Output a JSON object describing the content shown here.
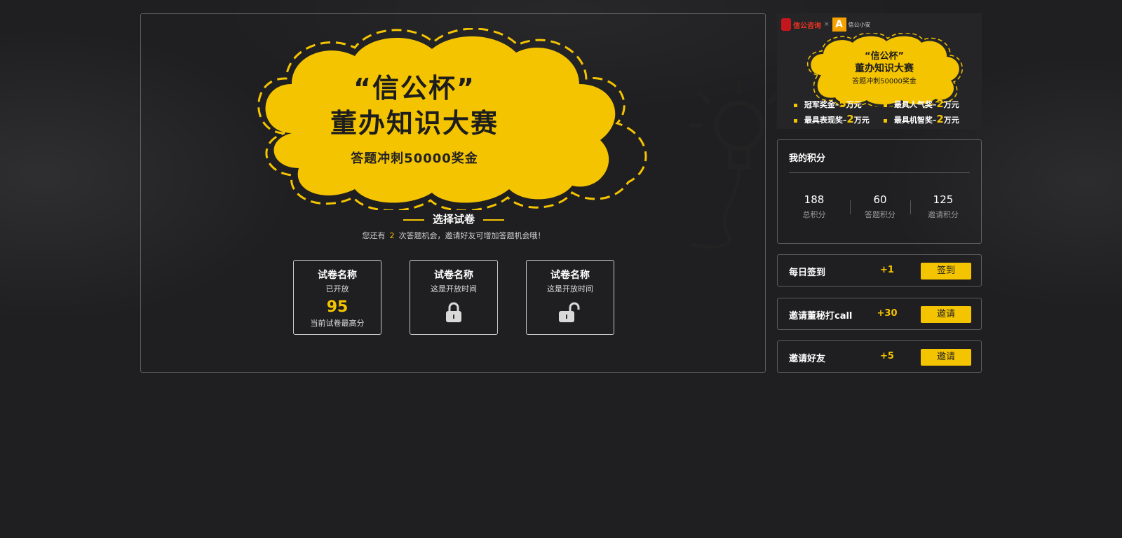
{
  "hero": {
    "title_line1": "“信公杯”",
    "title_line2": "董办知识大赛",
    "subtitle": "答题冲刺50000奖金"
  },
  "section": {
    "title": "选择试卷",
    "hint_prefix": "您还有",
    "hint_count": "2",
    "hint_suffix": "次答题机会，邀请好友可增加答题机会哦！"
  },
  "papers": [
    {
      "name": "试卷名称",
      "status": "已开放",
      "score": "95",
      "score_label": "当前试卷最高分",
      "state": "open"
    },
    {
      "name": "试卷名称",
      "status": "这是开放时间",
      "state": "locked"
    },
    {
      "name": "试卷名称",
      "status": "这是开放时间",
      "state": "unlocked"
    }
  ],
  "banner": {
    "brand1": "信公咨询",
    "brand_sep": "×",
    "brand2_logo": "A",
    "brand2": "信公小安",
    "title_line1": "“信公杯”",
    "title_line2": "董办知识大赛",
    "subtitle": "答题冲刺50000奖金",
    "prizes": [
      {
        "label": "冠军奖金–",
        "amount": "5",
        "unit": "万元"
      },
      {
        "label": "最具人气奖–",
        "amount": "2",
        "unit": "万元"
      },
      {
        "label": "最具表现奖–",
        "amount": "2",
        "unit": "万元"
      },
      {
        "label": "最具机智奖–",
        "amount": "2",
        "unit": "万元"
      }
    ]
  },
  "score": {
    "title": "我的积分",
    "stats": [
      {
        "value": "188",
        "label": "总积分"
      },
      {
        "value": "60",
        "label": "答题积分"
      },
      {
        "value": "125",
        "label": "邀请积分"
      }
    ]
  },
  "tasks": [
    {
      "name": "每日签到",
      "points": "+1",
      "button": "签到"
    },
    {
      "name": "邀请董秘打call",
      "points": "+30",
      "button": "邀请"
    },
    {
      "name": "邀请好友",
      "points": "+5",
      "button": "邀请"
    }
  ],
  "colors": {
    "accent": "#f5c400",
    "background": "#1f1f21"
  }
}
